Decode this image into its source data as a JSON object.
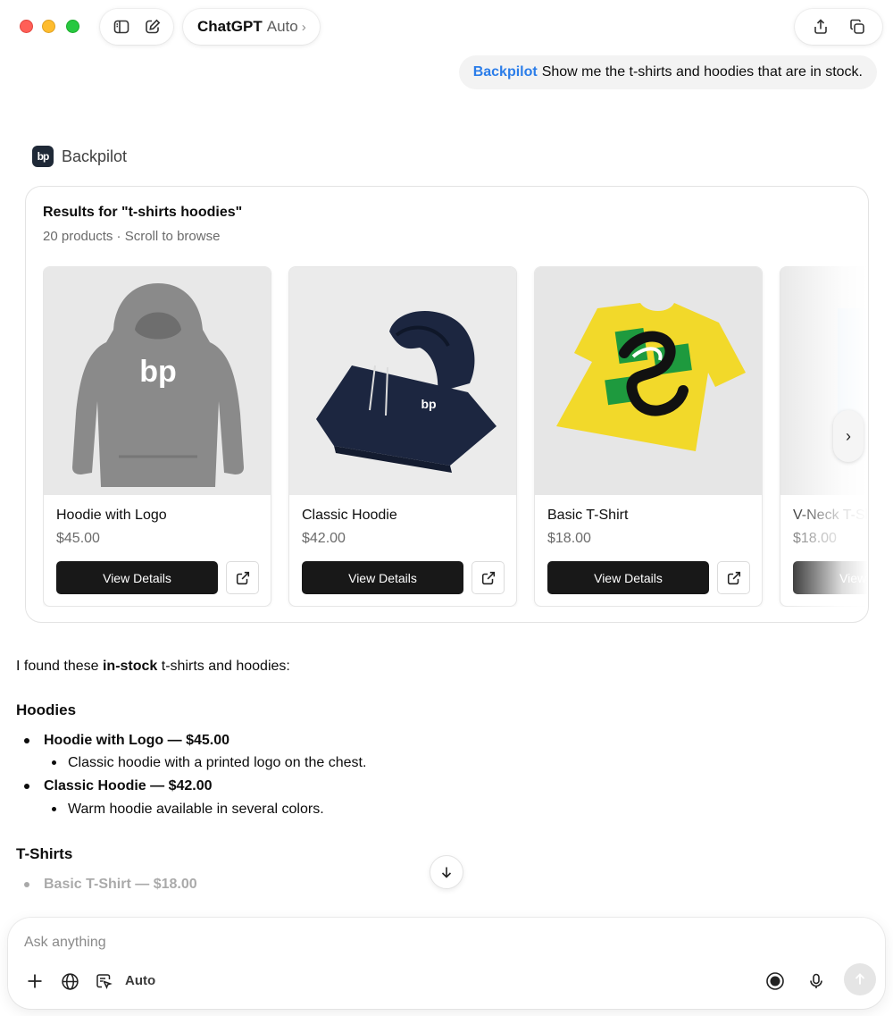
{
  "window": {
    "model_name": "ChatGPT",
    "model_mode": "Auto",
    "chevron": "›"
  },
  "user_message": {
    "app_mention": "Backpilot",
    "text": "Show me the t-shirts and hoodies that are in stock."
  },
  "app": {
    "logo_text": "bp",
    "name": "Backpilot"
  },
  "results": {
    "title": "Results for \"t-shirts hoodies\"",
    "subtitle": "20 products · Scroll to browse",
    "products": [
      {
        "name": "Hoodie with Logo",
        "price": "$45.00",
        "button": "View Details"
      },
      {
        "name": "Classic Hoodie",
        "price": "$42.00",
        "button": "View Details"
      },
      {
        "name": "Basic T-Shirt",
        "price": "$18.00",
        "button": "View Details"
      },
      {
        "name": "V-Neck T-Shirt",
        "price": "$18.00",
        "button": "View Details"
      }
    ],
    "next_label": "›"
  },
  "answer": {
    "intro_pre": "I found these ",
    "intro_bold": "in-stock",
    "intro_post": " t-shirts and hoodies:",
    "section1": "Hoodies",
    "item1": "Hoodie with Logo — $45.00",
    "item1_desc": "Classic hoodie with a printed logo on the chest.",
    "item2": "Classic Hoodie — $42.00",
    "item2_desc": "Warm hoodie available in several colors.",
    "section2": "T-Shirts",
    "item3": "Basic T-Shirt — $18.00"
  },
  "composer": {
    "placeholder": "Ask anything",
    "mode_label": "Auto"
  },
  "colors": {
    "accent": "#2b7de9",
    "button_dark": "#181818",
    "hoodie_grey": "#8a8a8a",
    "hoodie_navy": "#1c2640",
    "tshirt_yellow": "#f2d92a"
  }
}
